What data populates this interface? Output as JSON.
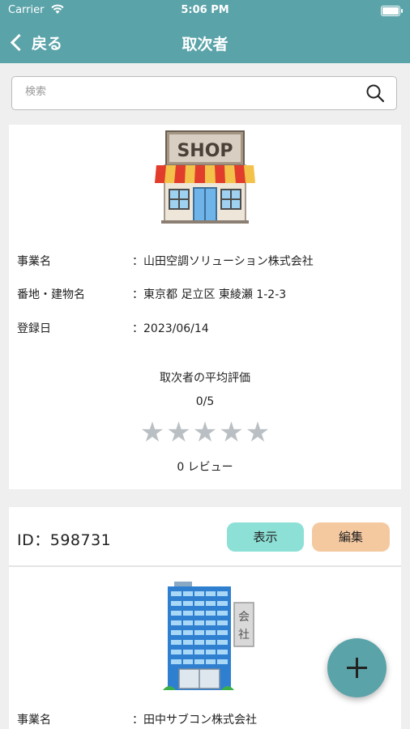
{
  "status_bar": {
    "carrier": "Carrier",
    "time": "5:06 PM"
  },
  "nav": {
    "back_label": "戻る",
    "title": "取次者"
  },
  "search": {
    "placeholder": "検索"
  },
  "card1": {
    "icon": "shop-icon",
    "fields": [
      {
        "label": "事業名",
        "value": "：山田空調ソリューション株式会社"
      },
      {
        "label": "番地・建物名",
        "value": "：東京都 足立区 東綾瀬 1-2-3"
      },
      {
        "label": "登録日",
        "value": "：2023/06/14"
      }
    ],
    "rating_title": "取次者の平均評価",
    "rating_value": "0/5",
    "rating_fraction": 0,
    "stars_total": 5,
    "review_count": "0 レビュー"
  },
  "card2": {
    "id_text": "ID：598731",
    "show_button": "表示",
    "edit_button": "編集",
    "icon": "office-building-icon",
    "fields": [
      {
        "label": "事業名",
        "value": "：田中サブコン株式会社"
      }
    ]
  },
  "fab": {
    "icon": "plus-icon"
  },
  "colors": {
    "header": "#5aa3a9",
    "show_button": "#8ce0d6",
    "edit_button": "#f5c9a0",
    "star_empty": "#b9bfc3"
  }
}
